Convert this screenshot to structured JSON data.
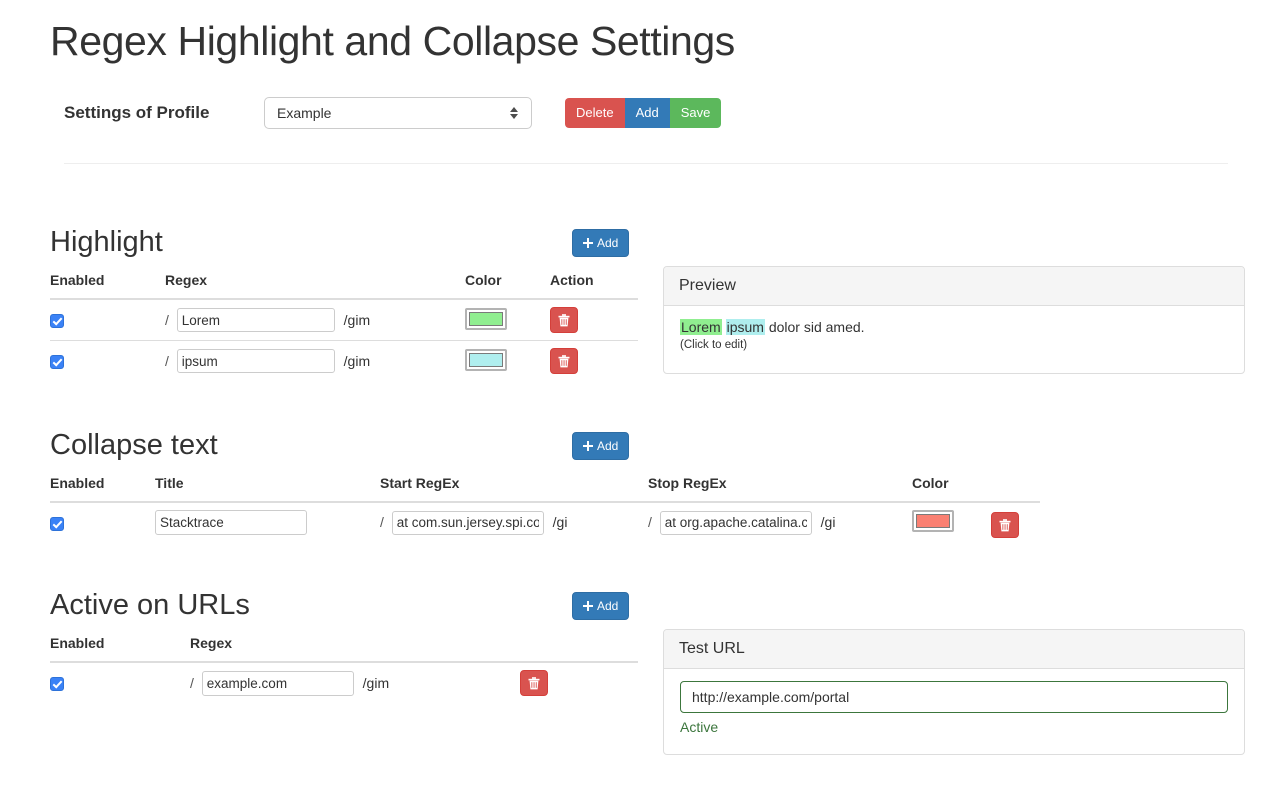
{
  "page_title": "Regex Highlight and Collapse Settings",
  "profile": {
    "label": "Settings of Profile",
    "selected": "Example",
    "options": [
      "Example"
    ],
    "spinner_icon": "updown-spinner-icon",
    "buttons": {
      "delete": "Delete",
      "add": "Add",
      "save": "Save"
    },
    "colors": {
      "delete": "#d9534f",
      "add": "#337ab7",
      "save": "#5cb85c"
    }
  },
  "highlight": {
    "heading": "Highlight",
    "add_label": "Add",
    "add_icon": "plus-icon",
    "columns": [
      "Enabled",
      "Regex",
      "Color",
      "Action"
    ],
    "rows": [
      {
        "enabled": true,
        "prefix": "/",
        "regex": "Lorem",
        "flags": "/gim",
        "color": "#90ee90",
        "delete_icon": "trash-icon"
      },
      {
        "enabled": true,
        "prefix": "/",
        "regex": "ipsum",
        "flags": "/gim",
        "color": "#afeeee",
        "delete_icon": "trash-icon"
      }
    ]
  },
  "preview": {
    "title": "Preview",
    "segments": [
      {
        "text": "Lorem",
        "highlight": "#90ee90"
      },
      {
        "text": " ",
        "highlight": ""
      },
      {
        "text": "ipsum",
        "highlight": "#afeeee"
      },
      {
        "text": " dolor sid amed.",
        "highlight": ""
      }
    ],
    "hint": "(Click to edit)"
  },
  "collapse": {
    "heading": "Collapse text",
    "add_label": "Add",
    "add_icon": "plus-icon",
    "columns": [
      "Enabled",
      "Title",
      "Start RegEx",
      "Stop RegEx",
      "Color"
    ],
    "rows": [
      {
        "enabled": true,
        "title": "Stacktrace",
        "start_prefix": "/",
        "start_regex": "at com.sun.jersey.spi.co",
        "start_flags": "/gi",
        "stop_prefix": "/",
        "stop_regex": "at org.apache.catalina.co",
        "stop_flags": "/gi",
        "color": "#fa8072",
        "delete_icon": "trash-icon"
      }
    ]
  },
  "urls": {
    "heading": "Active on URLs",
    "add_label": "Add",
    "add_icon": "plus-icon",
    "columns": [
      "Enabled",
      "Regex"
    ],
    "rows": [
      {
        "enabled": true,
        "prefix": "/",
        "regex": "example.com",
        "flags": "/gim",
        "delete_icon": "trash-icon"
      }
    ]
  },
  "test_url": {
    "title": "Test URL",
    "value": "http://example.com/portal",
    "placeholder": "http://example.com/portal",
    "status": "Active",
    "status_color": "#3c763d"
  }
}
